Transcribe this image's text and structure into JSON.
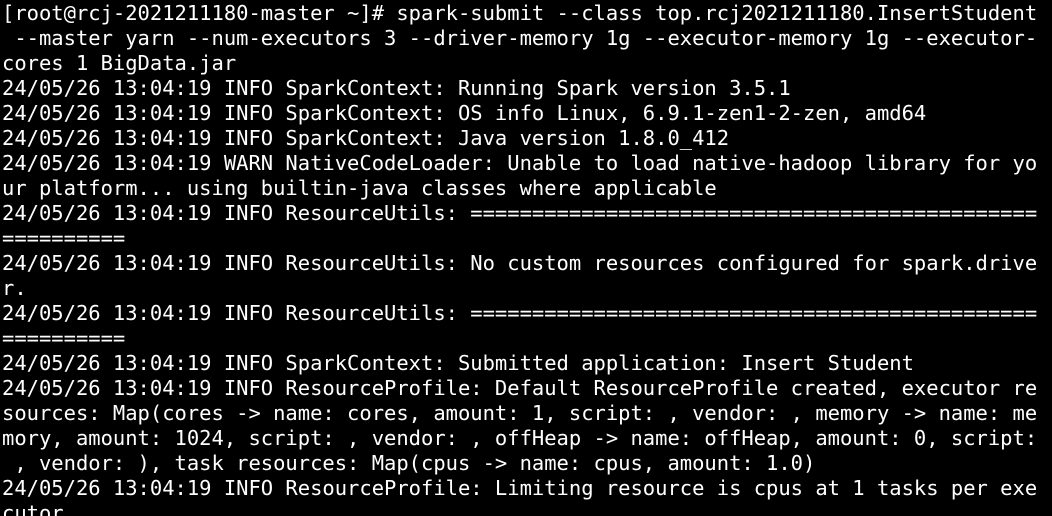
{
  "terminal": {
    "lines": [
      "[root@rcj-2021211180-master ~]# spark-submit --class top.rcj2021211180.InsertStudent",
      " --master yarn --num-executors 3 --driver-memory 1g --executor-memory 1g --executor-",
      "cores 1 BigData.jar",
      "24/05/26 13:04:19 INFO SparkContext: Running Spark version 3.5.1",
      "24/05/26 13:04:19 INFO SparkContext: OS info Linux, 6.9.1-zen1-2-zen, amd64",
      "24/05/26 13:04:19 INFO SparkContext: Java version 1.8.0_412",
      "24/05/26 13:04:19 WARN NativeCodeLoader: Unable to load native-hadoop library for yo",
      "ur platform... using builtin-java classes where applicable",
      "24/05/26 13:04:19 INFO ResourceUtils: ==============================================",
      "==========",
      "24/05/26 13:04:19 INFO ResourceUtils: No custom resources configured for spark.drive",
      "r.",
      "24/05/26 13:04:19 INFO ResourceUtils: ==============================================",
      "==========",
      "24/05/26 13:04:19 INFO SparkContext: Submitted application: Insert Student",
      "24/05/26 13:04:19 INFO ResourceProfile: Default ResourceProfile created, executor re",
      "sources: Map(cores -> name: cores, amount: 1, script: , vendor: , memory -> name: me",
      "mory, amount: 1024, script: , vendor: , offHeap -> name: offHeap, amount: 0, script:",
      " , vendor: ), task resources: Map(cpus -> name: cpus, amount: 1.0)",
      "24/05/26 13:04:19 INFO ResourceProfile: Limiting resource is cpus at 1 tasks per exe",
      "cutor"
    ]
  }
}
